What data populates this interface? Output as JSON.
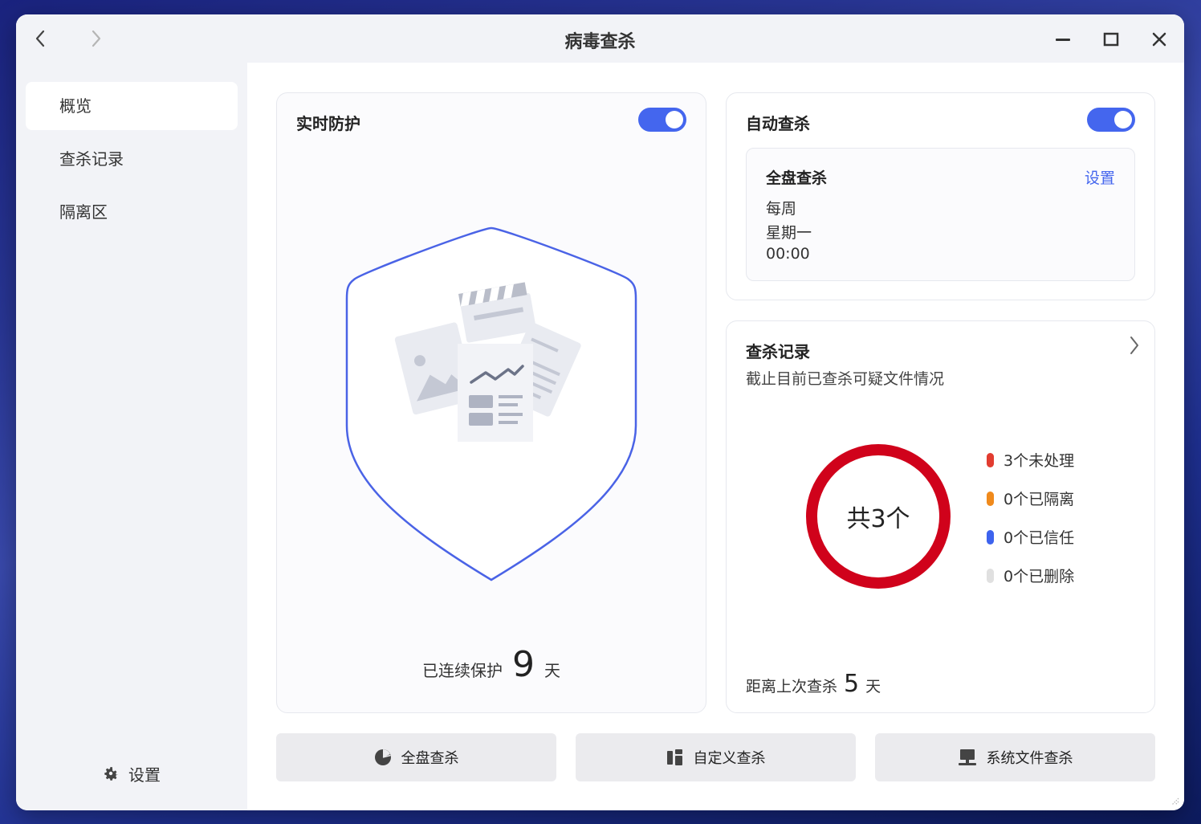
{
  "window": {
    "title": "病毒查杀"
  },
  "sidebar": {
    "items": [
      {
        "label": "概览",
        "active": true
      },
      {
        "label": "查杀记录",
        "active": false
      },
      {
        "label": "隔离区",
        "active": false
      }
    ],
    "settings_label": "设置"
  },
  "realtime": {
    "title": "实时防护",
    "enabled": true,
    "protect_prefix": "已连续保护",
    "protect_days": "9",
    "protect_suffix": "天"
  },
  "auto_scan": {
    "title": "自动查杀",
    "enabled": true,
    "schedule": {
      "title": "全盘查杀",
      "link": "设置",
      "frequency": "每周",
      "day": "星期一",
      "time": "00:00"
    }
  },
  "records": {
    "title": "查杀记录",
    "subtitle": "截止目前已查杀可疑文件情况",
    "total_label": "共3个",
    "legend": [
      {
        "label": "3个未处理",
        "color": "#e23c30"
      },
      {
        "label": "0个已隔离",
        "color": "#f08a1c"
      },
      {
        "label": "0个已信任",
        "color": "#3d63ee"
      },
      {
        "label": "0个已删除",
        "color": "#e0e0e0"
      }
    ],
    "ring_color": "#d0021b",
    "last_prefix": "距离上次查杀",
    "last_days": "5",
    "last_suffix": "天"
  },
  "actions": {
    "full_scan": "全盘查杀",
    "custom_scan": "自定义查杀",
    "system_scan": "系统文件查杀"
  },
  "colors": {
    "accent": "#4466ee",
    "shield_stroke": "#4a63e6"
  }
}
